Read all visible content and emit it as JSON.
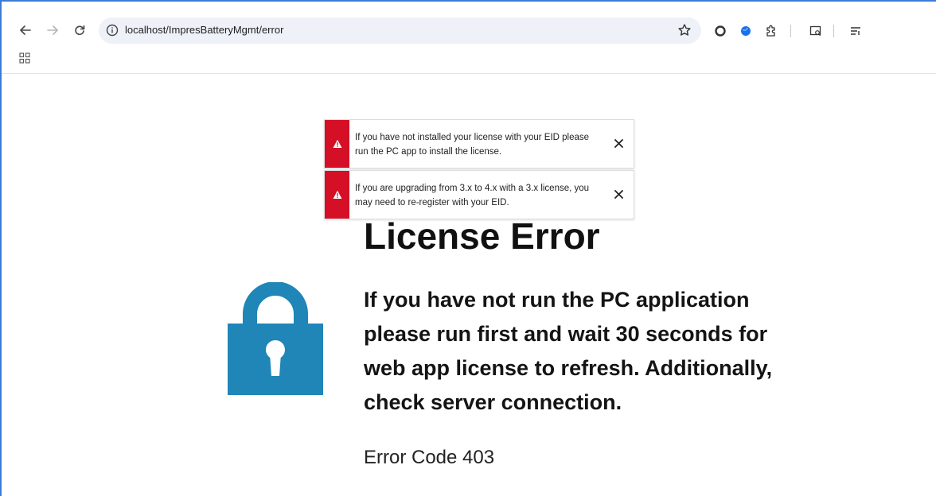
{
  "browser": {
    "url": "localhost/ImpresBatteryMgmt/error",
    "icons": [
      "back-arrow-icon",
      "forward-arrow-icon",
      "reload-icon",
      "info-icon",
      "star-icon",
      "extension-circle-icon",
      "globe-extension-icon",
      "puzzle-icon",
      "tab-search-icon",
      "reading-list-icon",
      "apps-grid-icon"
    ]
  },
  "toasts": [
    {
      "icon": "warning-icon",
      "message": "If you have not installed your license with your EID please run the PC app to install the license.",
      "close_icon": "close-icon"
    },
    {
      "icon": "warning-icon",
      "message": "If you are upgrading from 3.x to 4.x with a 3.x license, you may need to re-register with your EID.",
      "close_icon": "close-icon"
    }
  ],
  "main": {
    "title": "License Error",
    "message": "If you have not run the PC application please run first and wait 30 seconds for web app license to refresh. Additionally, check server connection.",
    "error_code": "Error Code 403",
    "lock_icon": "lock-icon"
  },
  "colors": {
    "toast_accent": "#d50f25",
    "lock": "#1f86b7",
    "window_border": "#3c7bd6",
    "omnibox_bg": "#eef1f8"
  }
}
